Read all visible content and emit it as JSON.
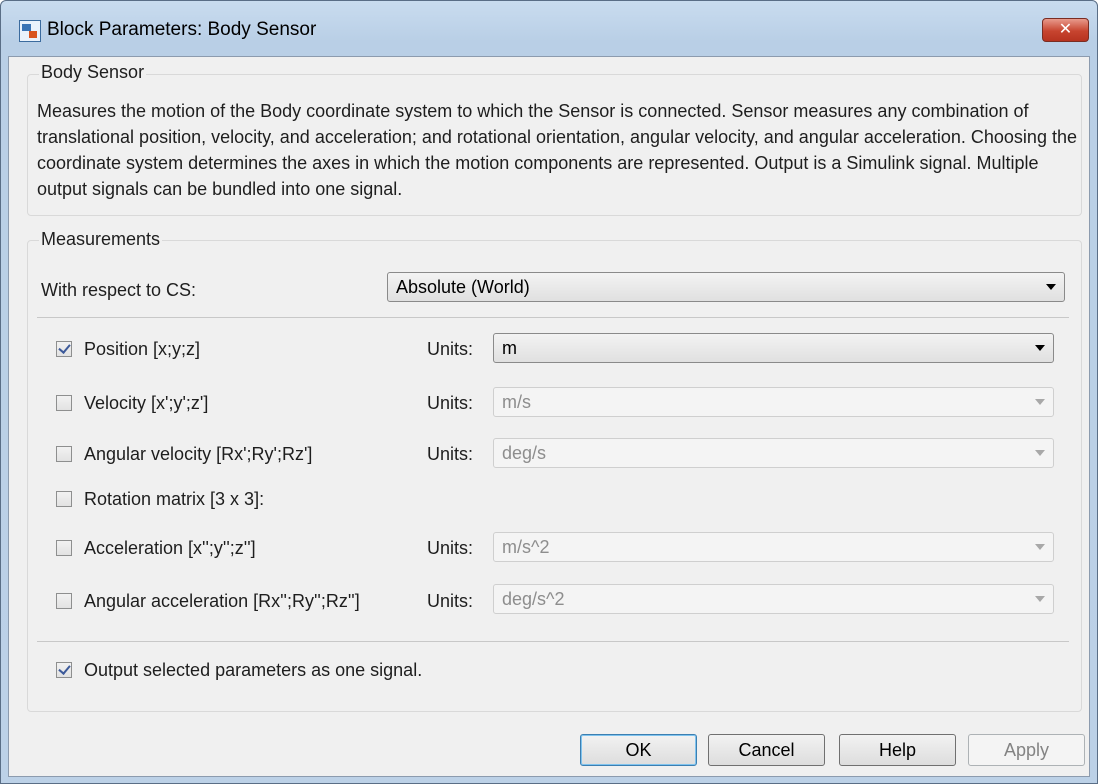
{
  "window": {
    "title": "Block Parameters: Body Sensor",
    "close_glyph": "✕"
  },
  "info": {
    "group_title": "Body Sensor",
    "description": "Measures the motion of the Body coordinate system to which the Sensor is connected. Sensor measures any combination of translational position, velocity, and acceleration; and rotational orientation, angular velocity, and angular acceleration. Choosing the coordinate system determines the axes in which the motion components are represented. Output is a Simulink signal. Multiple output signals can be bundled into one signal."
  },
  "measurements": {
    "group_title": "Measurements",
    "cs_label": "With respect to CS:",
    "cs_value": "Absolute (World)",
    "rows": [
      {
        "label": "Position [x;y;z]",
        "checked": true,
        "units_label": "Units:",
        "units_value": "m",
        "enabled": true
      },
      {
        "label": "Velocity [x';y';z']",
        "checked": false,
        "units_label": "Units:",
        "units_value": "m/s",
        "enabled": false
      },
      {
        "label": "Angular velocity [Rx';Ry';Rz']",
        "checked": false,
        "units_label": "Units:",
        "units_value": "deg/s",
        "enabled": false
      },
      {
        "label": "Rotation matrix [3 x 3]:",
        "checked": false
      },
      {
        "label": "Acceleration [x'';y'';z'']",
        "checked": false,
        "units_label": "Units:",
        "units_value": "m/s^2",
        "enabled": false
      },
      {
        "label": "Angular acceleration [Rx'';Ry'';Rz'']",
        "checked": false,
        "units_label": "Units:",
        "units_value": "deg/s^2",
        "enabled": false
      }
    ],
    "output_label": "Output selected parameters as one signal.",
    "output_checked": true
  },
  "buttons": {
    "ok": "OK",
    "cancel": "Cancel",
    "help": "Help",
    "apply": "Apply"
  }
}
